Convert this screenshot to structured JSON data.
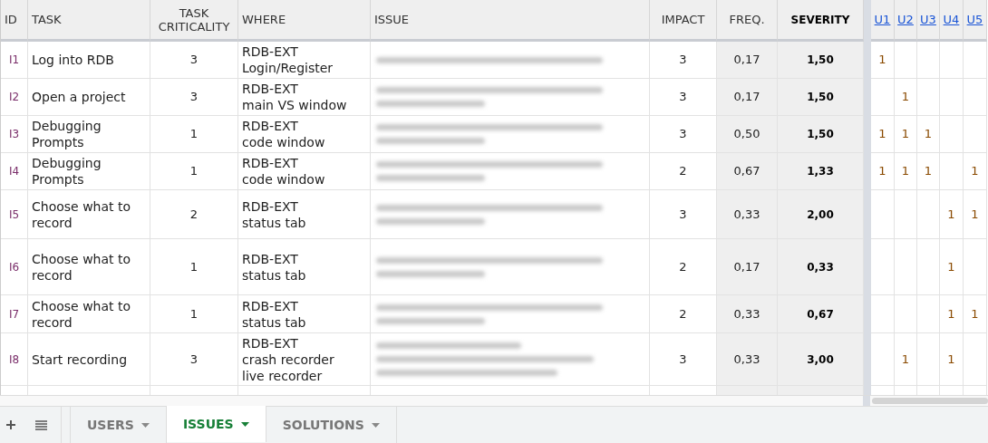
{
  "columns": [
    {
      "label": "ID",
      "kind": "plain"
    },
    {
      "label": "TASK",
      "kind": "plain"
    },
    {
      "label": "TASK CRITICALITY",
      "kind": "center"
    },
    {
      "label": "WHERE",
      "kind": "plain"
    },
    {
      "label": "ISSUE",
      "kind": "plain"
    },
    {
      "label": "IMPACT",
      "kind": "center"
    },
    {
      "label": "FREQ.",
      "kind": "center"
    },
    {
      "label": "SEVERITY",
      "kind": "bold"
    },
    {
      "label": "U1",
      "kind": "link"
    },
    {
      "label": "U2",
      "kind": "link"
    },
    {
      "label": "U3",
      "kind": "link"
    },
    {
      "label": "U4",
      "kind": "link"
    },
    {
      "label": "U5",
      "kind": "link"
    }
  ],
  "rows": [
    {
      "id": "I1",
      "task": "Log into RDB",
      "criticality": "3",
      "where": [
        "RDB-EXT",
        "Login/Register"
      ],
      "issue": {
        "kind": "oneline"
      },
      "impact": "3",
      "freq": "0,17",
      "severity": "1,50",
      "users": [
        {
          "has_mark": true,
          "value": "1"
        },
        {
          "has_mark": false
        },
        {
          "has_mark": false
        },
        {
          "has_mark": false
        },
        {
          "has_mark": false
        }
      ]
    },
    {
      "id": "I2",
      "task": "Open a project",
      "criticality": "3",
      "where": [
        "RDB-EXT",
        "main VS window"
      ],
      "issue": {
        "kind": "twoline"
      },
      "impact": "3",
      "freq": "0,17",
      "severity": "1,50",
      "users": [
        {
          "has_mark": false
        },
        {
          "has_mark": true,
          "value": "1"
        },
        {
          "has_mark": false
        },
        {
          "has_mark": false
        },
        {
          "has_mark": false
        }
      ]
    },
    {
      "id": "I3",
      "task": "Debugging Prompts",
      "criticality": "1",
      "where": [
        "RDB-EXT",
        "code window"
      ],
      "issue": {
        "kind": "twoline"
      },
      "impact": "3",
      "freq": "0,50",
      "severity": "1,50",
      "users": [
        {
          "has_mark": true,
          "value": "1"
        },
        {
          "has_mark": true,
          "value": "1"
        },
        {
          "has_mark": true,
          "value": "1"
        },
        {
          "has_mark": false
        },
        {
          "has_mark": false
        }
      ]
    },
    {
      "id": "I4",
      "task": "Debugging Prompts",
      "criticality": "1",
      "where": [
        "RDB-EXT",
        "code window"
      ],
      "issue": {
        "kind": "twoline"
      },
      "impact": "2",
      "freq": "0,67",
      "severity": "1,33",
      "users": [
        {
          "has_mark": true,
          "value": "1"
        },
        {
          "has_mark": true,
          "value": "1"
        },
        {
          "has_mark": true,
          "value": "1"
        },
        {
          "has_mark": false
        },
        {
          "has_mark": true,
          "value": "1"
        }
      ]
    },
    {
      "id": "I5",
      "task": "Choose what to record",
      "criticality": "2",
      "where": [
        "RDB-EXT",
        "status tab"
      ],
      "issue": {
        "kind": "twoline"
      },
      "impact": "3",
      "freq": "0,33",
      "severity": "2,00",
      "users": [
        {
          "has_mark": false
        },
        {
          "has_mark": false
        },
        {
          "has_mark": false
        },
        {
          "has_mark": true,
          "value": "1"
        },
        {
          "has_mark": true,
          "value": "1"
        }
      ]
    },
    {
      "id": "I6",
      "task": "Choose what to record",
      "criticality": "1",
      "where": [
        "RDB-EXT",
        "status tab"
      ],
      "issue": {
        "kind": "twoline"
      },
      "impact": "2",
      "freq": "0,17",
      "severity": "0,33",
      "users": [
        {
          "has_mark": false
        },
        {
          "has_mark": false
        },
        {
          "has_mark": false
        },
        {
          "has_mark": true,
          "value": "1"
        },
        {
          "has_mark": false
        }
      ]
    },
    {
      "id": "I7",
      "task": "Choose what to record",
      "criticality": "1",
      "where": [
        "RDB-EXT",
        "status tab"
      ],
      "issue": {
        "kind": "twoline"
      },
      "impact": "2",
      "freq": "0,33",
      "severity": "0,67",
      "users": [
        {
          "has_mark": false
        },
        {
          "has_mark": false
        },
        {
          "has_mark": false
        },
        {
          "has_mark": true,
          "value": "1"
        },
        {
          "has_mark": true,
          "value": "1"
        }
      ]
    },
    {
      "id": "I8",
      "task": "Start recording",
      "criticality": "3",
      "where": [
        "RDB-EXT",
        "crash recorder",
        "live recorder"
      ],
      "issue": {
        "kind": "threeline"
      },
      "impact": "3",
      "freq": "0,33",
      "severity": "3,00",
      "users": [
        {
          "has_mark": false
        },
        {
          "has_mark": true,
          "value": "1"
        },
        {
          "has_mark": false
        },
        {
          "has_mark": true,
          "value": "1"
        },
        {
          "has_mark": false
        }
      ]
    }
  ],
  "sheet_tabs": [
    {
      "label": "USERS",
      "selected": false
    },
    {
      "label": "ISSUES",
      "selected": true
    },
    {
      "label": "SOLUTIONS",
      "selected": false
    }
  ]
}
